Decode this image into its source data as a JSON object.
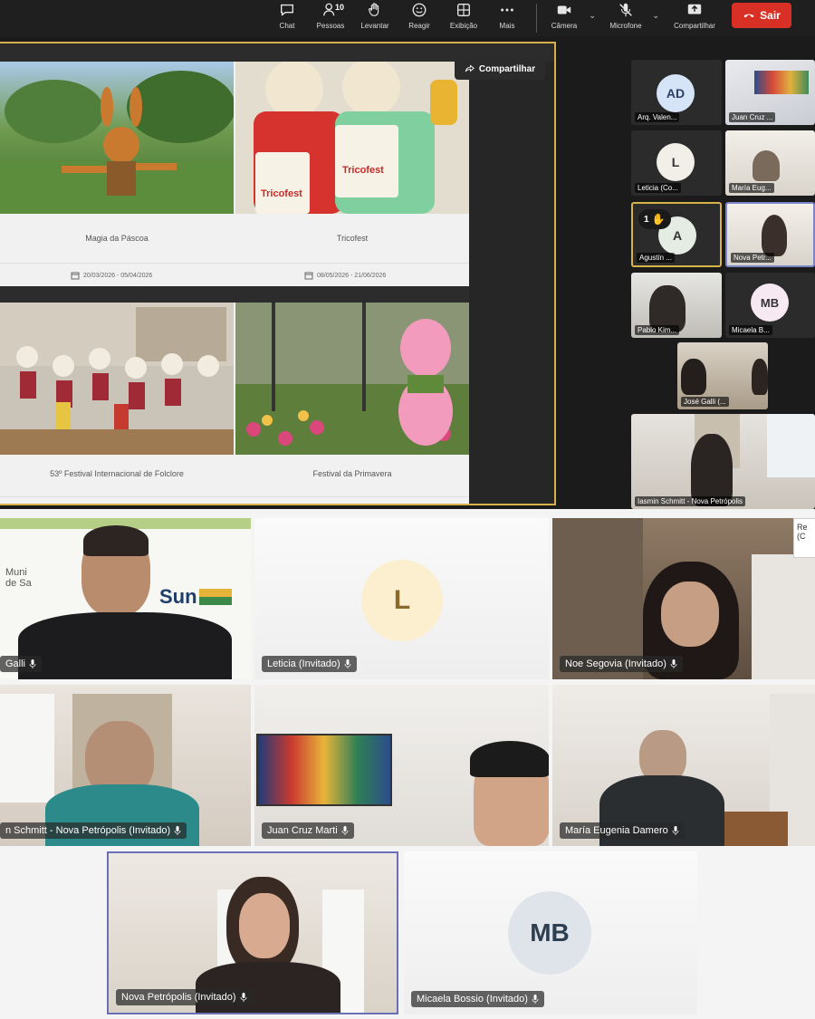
{
  "toolbar": {
    "chat": "Chat",
    "people": "Pessoas",
    "people_count": "10",
    "raise_hand": "Levantar",
    "react": "Reagir",
    "view": "Exibição",
    "more": "Mais",
    "camera": "Câmera",
    "mic": "Microfone",
    "share": "Compartilhar",
    "leave": "Sair"
  },
  "share_screen": {
    "share_button": "Compartilhar",
    "events": [
      {
        "name": "Magia da Páscoa",
        "date": "20/03/2026 - 05/04/2026"
      },
      {
        "name": "Tricofest",
        "date": "08/05/2026 - 21/06/2026",
        "banner": "Tricofest"
      },
      {
        "name": "53º Festival Internacional de Folclore",
        "date": ""
      },
      {
        "name": "Festival da Primavera",
        "date": ""
      }
    ]
  },
  "side_participants": [
    {
      "initials": "AD",
      "label": "Arq. Valen..."
    },
    {
      "initials": "",
      "label": "Juan Cruz ..."
    },
    {
      "initials": "L",
      "label": "Leticia (Co..."
    },
    {
      "initials": "",
      "label": "María Eug..."
    },
    {
      "initials": "A",
      "label": "Agustín ...",
      "hand_count": "1"
    },
    {
      "initials": "",
      "label": "Nova Petr..."
    },
    {
      "initials": "",
      "label": "Pablo Kim..."
    },
    {
      "initials": "MB",
      "label": "Micaela B..."
    },
    {
      "initials": "",
      "label": "José Galli (..."
    },
    {
      "initials": "",
      "label": "Iasmin Schmitt - Nova Petrópolis"
    }
  ],
  "gallery": [
    {
      "label": "Galli",
      "banner_text": "Sun",
      "banner_text2": "Muni de Sa"
    },
    {
      "label": "Leticia (Invitado)",
      "initials": "L"
    },
    {
      "label": "Noe Segovia (Invitado)"
    },
    {
      "label": "n Schmitt - Nova Petrópolis (Invitado)"
    },
    {
      "label": "Juan Cruz Marti"
    },
    {
      "label": "María Eugenia Damero"
    },
    {
      "label": "Nova Petrópolis (Invitado)"
    },
    {
      "label": "Micaela Bossio (Invitado)",
      "initials": "MB"
    }
  ],
  "tooltip": {
    "line1": "Re",
    "line2": "(C"
  }
}
